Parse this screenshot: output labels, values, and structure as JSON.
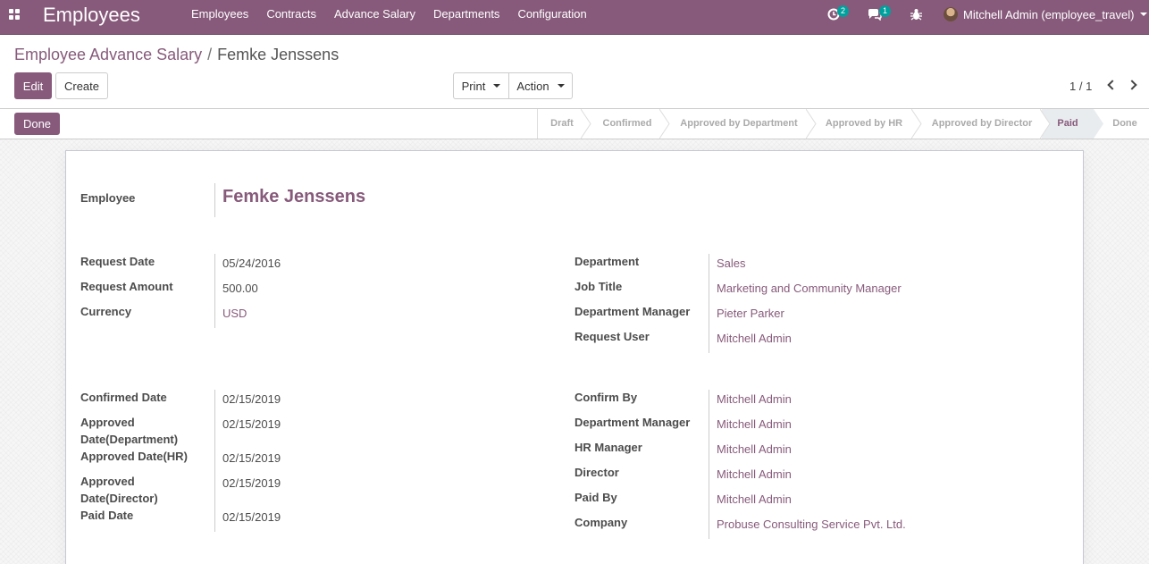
{
  "navbar": {
    "brand": "Employees",
    "menu": [
      "Employees",
      "Contracts",
      "Advance Salary",
      "Departments",
      "Configuration"
    ],
    "activity_count": "2",
    "message_count": "1",
    "user": "Mitchell Admin (employee_travel)"
  },
  "breadcrumb": {
    "parent": "Employee Advance Salary",
    "separator": "/",
    "current": "Femke Jenssens"
  },
  "buttons": {
    "edit": "Edit",
    "create": "Create",
    "print": "Print",
    "action": "Action",
    "done": "Done"
  },
  "pager": "1 / 1",
  "stages": [
    "Draft",
    "Confirmed",
    "Approved by Department",
    "Approved by HR",
    "Approved by Director",
    "Paid",
    "Done"
  ],
  "active_stage": "Paid",
  "form": {
    "employee_label": "Employee",
    "employee_name": "Femke Jenssens",
    "left1": [
      {
        "label": "Request Date",
        "value": "05/24/2016"
      },
      {
        "label": "Request Amount",
        "value": "500.00"
      },
      {
        "label": "Currency",
        "value": "USD"
      }
    ],
    "right1": [
      {
        "label": "Department",
        "value": "Sales"
      },
      {
        "label": "Job Title",
        "value": "Marketing and Community Manager"
      },
      {
        "label": "Department Manager",
        "value": "Pieter Parker"
      },
      {
        "label": "Request User",
        "value": "Mitchell Admin"
      }
    ],
    "left2": [
      {
        "label": "Confirmed Date",
        "value": "02/15/2019"
      },
      {
        "label_line1": "Approved",
        "label_line2": "Date(Department)",
        "value": "02/15/2019"
      },
      {
        "label": "Approved Date(HR)",
        "value": "02/15/2019"
      },
      {
        "label_line1": "Approved",
        "label_line2": "Date(Director)",
        "value": "02/15/2019"
      },
      {
        "label": "Paid Date",
        "value": "02/15/2019"
      }
    ],
    "right2": [
      {
        "label": "Confirm By",
        "value": "Mitchell Admin"
      },
      {
        "label": "Department Manager",
        "value": "Mitchell Admin"
      },
      {
        "label": "HR Manager",
        "value": "Mitchell Admin"
      },
      {
        "label": "Director",
        "value": "Mitchell Admin"
      },
      {
        "label": "Paid By",
        "value": "Mitchell Admin"
      },
      {
        "label": "Company",
        "value": "Probuse Consulting Service Pvt. Ltd."
      }
    ]
  },
  "colors": {
    "brand": "#875a7b",
    "badge": "#00a09d"
  },
  "icons": [
    "apps-icon",
    "activity-icon",
    "chat-icon",
    "bug-icon",
    "chevron-left-icon",
    "chevron-right-icon"
  ]
}
